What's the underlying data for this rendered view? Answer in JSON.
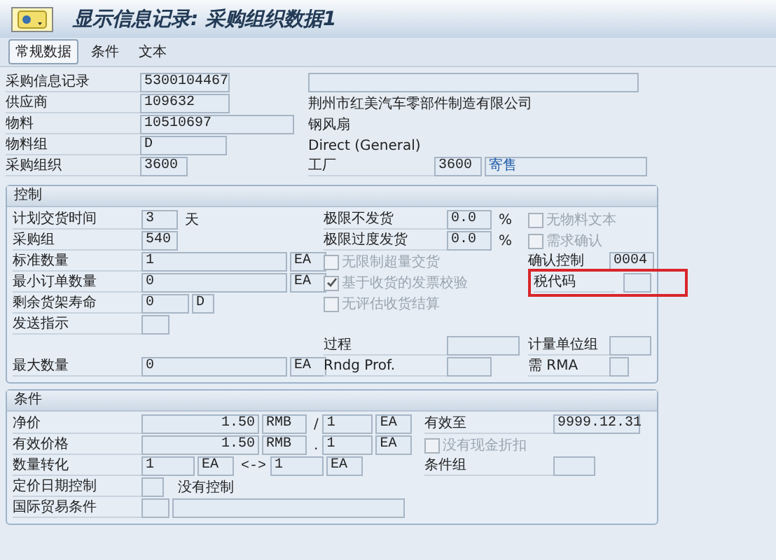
{
  "title": "显示信息记录: 采购组织数据1",
  "tabs": [
    {
      "label": "常规数据",
      "selected": true
    },
    {
      "label": "条件",
      "selected": false
    },
    {
      "label": "文本",
      "selected": false
    }
  ],
  "header": {
    "info_record": {
      "label": "采购信息记录",
      "value": "5300104467"
    },
    "vendor": {
      "label": "供应商",
      "value": "109632",
      "name": "荆州市红美汽车零部件制造有限公司"
    },
    "material": {
      "label": "物料",
      "value": "10510697",
      "name": "钢风扇"
    },
    "material_group": {
      "label": "物料组",
      "value": "D",
      "name": "Direct (General)"
    },
    "purch_org": {
      "label": "采购组织",
      "value": "3600"
    },
    "plant": {
      "label": "工厂",
      "value": "3600",
      "name": "寄售"
    }
  },
  "control": {
    "title": "控制",
    "planned_delivery": {
      "label": "计划交货时间",
      "value": "3",
      "unit": "天"
    },
    "purchasing_group": {
      "label": "采购组",
      "value": "540"
    },
    "standard_qty": {
      "label": "标准数量",
      "value": "1",
      "unit": "EA"
    },
    "min_qty": {
      "label": "最小订单数量",
      "value": "0",
      "unit": "EA"
    },
    "shelf_life": {
      "label": "剩余货架寿命",
      "value": "0",
      "unit": "D"
    },
    "shipping_instr": {
      "label": "发送指示"
    },
    "max_qty": {
      "label": "最大数量",
      "value": "0",
      "unit": "EA"
    },
    "underdelivery": {
      "label": "极限不发货",
      "value": "0.0",
      "unit": "%"
    },
    "overdelivery": {
      "label": "极限过度发货",
      "value": "0.0",
      "unit": "%"
    },
    "middle_checkboxes": [
      {
        "label": "无限制超量交货",
        "checked": false,
        "disabled": true
      },
      {
        "label": "基于收货的发票校验",
        "checked": true,
        "disabled": true
      },
      {
        "label": "无评估收货结算",
        "checked": false,
        "disabled": true
      }
    ],
    "procedure": {
      "label": "过程"
    },
    "rounding": {
      "label": "Rndg Prof."
    },
    "right_checkboxes": [
      {
        "label": "无物料文本",
        "checked": false,
        "disabled": true
      },
      {
        "label": "需求确认",
        "checked": false,
        "disabled": true
      }
    ],
    "conf_control": {
      "label": "确认控制",
      "value": "0004"
    },
    "tax_code": {
      "label": "税代码",
      "highlighted": true
    },
    "unit_group": {
      "label": "计量单位组"
    },
    "rma": {
      "label": "需 RMA"
    }
  },
  "conditions": {
    "title": "条件",
    "net_price": {
      "label": "净价",
      "amount": "1.50",
      "currency": "RMB",
      "separator": "/",
      "per": "1",
      "unit": "EA"
    },
    "effective_price": {
      "label": "有效价格",
      "amount": "1.50",
      "currency": "RMB",
      "separator": ".",
      "per": "1",
      "unit": "EA"
    },
    "qty_conversion": {
      "label": "数量转化",
      "from": "1",
      "from_unit": "EA",
      "arrow": "<->",
      "to": "1",
      "to_unit": "EA"
    },
    "pricing_date": {
      "label": "定价日期控制",
      "text": "没有控制"
    },
    "incoterms": {
      "label": "国际贸易条件"
    },
    "valid_to": {
      "label": "有效至",
      "value": "9999.12.31"
    },
    "no_cash_discount": {
      "label": "没有现金折扣",
      "checked": false,
      "disabled": true
    },
    "condition_group": {
      "label": "条件组"
    }
  }
}
